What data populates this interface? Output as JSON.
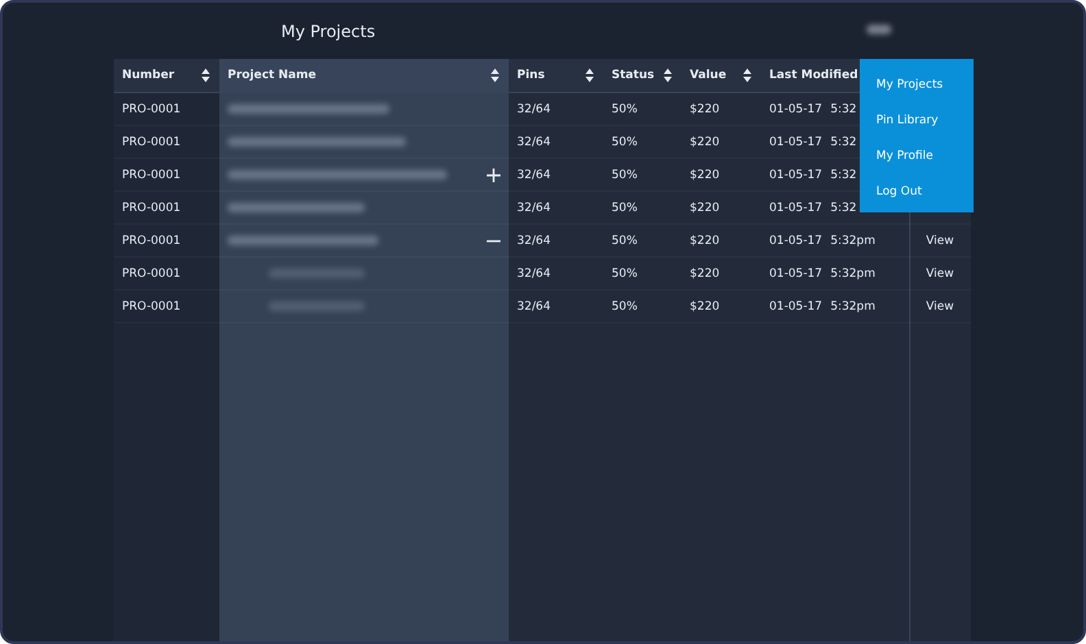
{
  "header": {
    "title": "My Projects"
  },
  "table": {
    "columns": [
      {
        "label": "Number"
      },
      {
        "label": "Project Name"
      },
      {
        "label": "Pins"
      },
      {
        "label": "Status"
      },
      {
        "label": "Value"
      },
      {
        "label": "Last Modified"
      }
    ],
    "rows": [
      {
        "number": "PRO-0001",
        "pins": "32/64",
        "status": "50%",
        "value": "$220",
        "date": "01-05-17",
        "time": "5:32"
      },
      {
        "number": "PRO-0001",
        "pins": "32/64",
        "status": "50%",
        "value": "$220",
        "date": "01-05-17",
        "time": "5:32"
      },
      {
        "number": "PRO-0001",
        "pins": "32/64",
        "status": "50%",
        "value": "$220",
        "date": "01-05-17",
        "time": "5:32",
        "expanded": false
      },
      {
        "number": "PRO-0001",
        "pins": "32/64",
        "status": "50%",
        "value": "$220",
        "date": "01-05-17",
        "time": "5:32"
      },
      {
        "number": "PRO-0001",
        "pins": "32/64",
        "status": "50%",
        "value": "$220",
        "date": "01-05-17",
        "time": "5:32pm",
        "action": "View",
        "expanded": true,
        "children": [
          {
            "number": "PRO-0001",
            "pins": "32/64",
            "status": "50%",
            "value": "$220",
            "date": "01-05-17",
            "time": "5:32pm",
            "action": "View"
          },
          {
            "number": "PRO-0001",
            "pins": "32/64",
            "status": "50%",
            "value": "$220",
            "date": "01-05-17",
            "time": "5:32pm",
            "action": "View"
          }
        ]
      }
    ]
  },
  "user_menu": {
    "items": [
      "My Projects",
      "Pin Library",
      "My Profile",
      "Log Out"
    ]
  }
}
